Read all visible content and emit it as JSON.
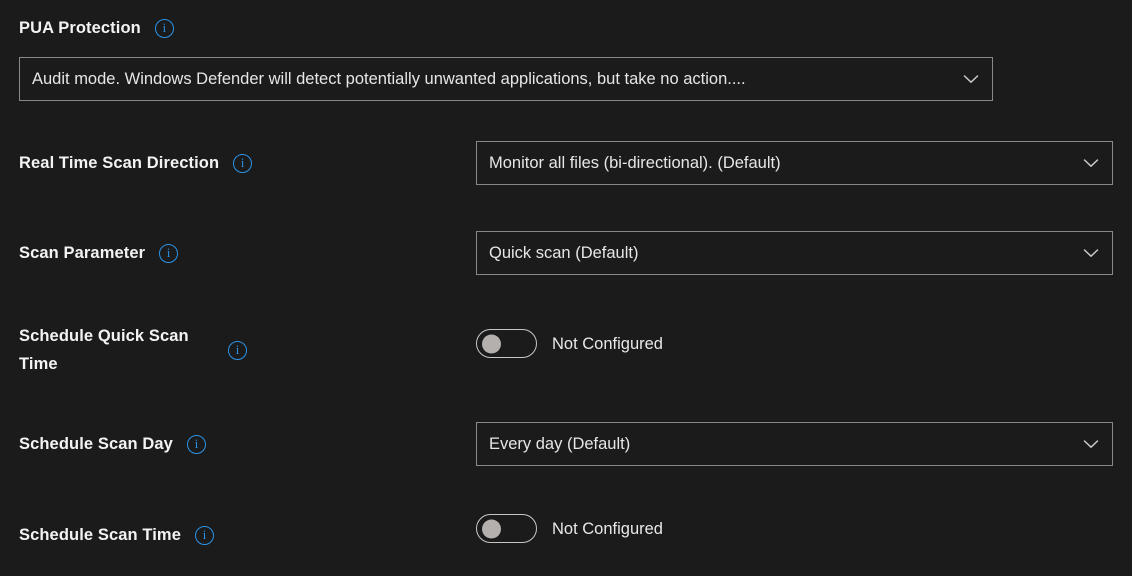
{
  "theme": {
    "background": "#1b1b1b",
    "text": "#f3f3f3",
    "accent": "#2b93e8",
    "border": "#8a8886",
    "toggle_knob": "#b3b0ad"
  },
  "icons": {
    "info": "i",
    "chevron_down": "chevron-down-icon"
  },
  "settings": [
    {
      "id": "pua-protection",
      "label": "PUA Protection",
      "info": "i",
      "control": "dropdown",
      "value": "Audit mode. Windows Defender will detect potentially unwanted applications, but take no action...."
    },
    {
      "id": "real-time-scan-direction",
      "label": "Real Time Scan Direction",
      "info": "i",
      "control": "dropdown",
      "value": "Monitor all files (bi-directional). (Default)"
    },
    {
      "id": "scan-parameter",
      "label": "Scan Parameter",
      "info": "i",
      "control": "dropdown",
      "value": "Quick scan (Default)"
    },
    {
      "id": "schedule-quick-scan-time",
      "label": "Schedule Quick Scan Time",
      "info": "i",
      "control": "toggle",
      "value": "Not Configured",
      "state": "off"
    },
    {
      "id": "schedule-scan-day",
      "label": "Schedule Scan Day",
      "info": "i",
      "control": "dropdown",
      "value": "Every day (Default)"
    },
    {
      "id": "schedule-scan-time",
      "label": "Schedule Scan Time",
      "info": "i",
      "control": "toggle",
      "value": "Not Configured",
      "state": "off"
    }
  ]
}
